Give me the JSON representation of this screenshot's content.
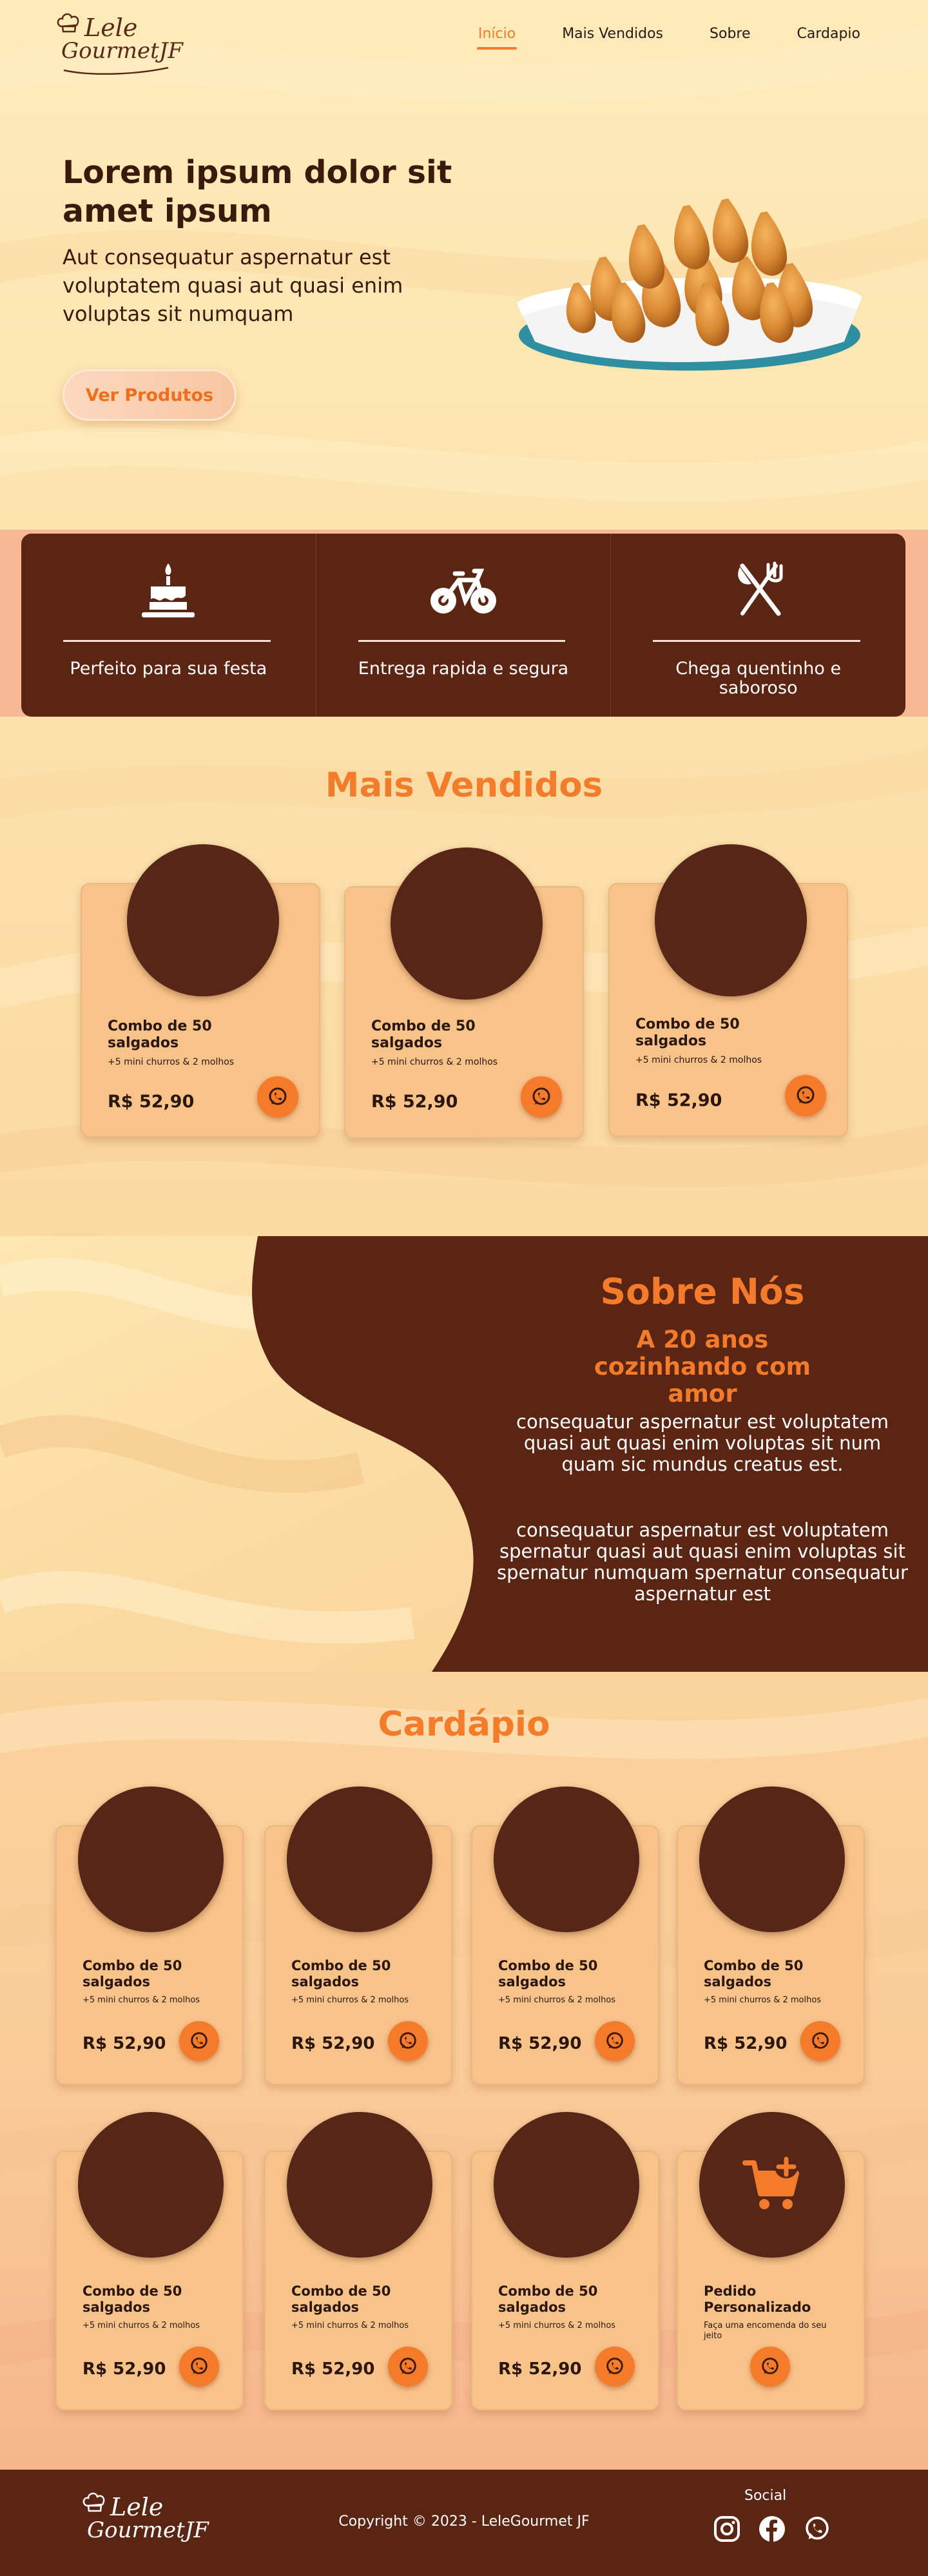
{
  "header": {
    "logo_line1": "Lele",
    "logo_line2": "GourmetJF",
    "nav": [
      {
        "label": "Início",
        "active": true
      },
      {
        "label": "Mais Vendidos",
        "active": false
      },
      {
        "label": "Sobre",
        "active": false
      },
      {
        "label": "Cardapio",
        "active": false
      }
    ]
  },
  "hero": {
    "title": "Lorem ipsum dolor sit amet ipsum",
    "subtitle": "Aut consequatur aspernatur est voluptatem quasi aut quasi enim voluptas sit numquam",
    "button": "Ver Produtos",
    "image_icon": "coxinha-plate-image"
  },
  "features": [
    {
      "icon": "cake-icon",
      "text": "Perfeito para sua festa"
    },
    {
      "icon": "bicycle-icon",
      "text": "Entrega rapida e segura"
    },
    {
      "icon": "fork-knife-icon",
      "text": "Chega quentinho e saboroso"
    }
  ],
  "best_sellers": {
    "title": "Mais Vendidos",
    "items": [
      {
        "name": "Combo de 50 salgados",
        "desc": "+5 mini churros & 2 molhos",
        "price": "R$ 52,90"
      },
      {
        "name": "Combo de 50 salgados",
        "desc": "+5 mini churros & 2 molhos",
        "price": "R$ 52,90"
      },
      {
        "name": "Combo de 50 salgados",
        "desc": "+5 mini churros & 2 molhos",
        "price": "R$ 52,90"
      }
    ]
  },
  "about": {
    "title": "Sobre Nós",
    "subtitle": "A 20 anos cozinhando com amor",
    "p1": "consequatur aspernatur est voluptatem quasi aut quasi enim voluptas sit num quam sic mundus creatus est.",
    "p2": "consequatur aspernatur est voluptatem spernatur quasi aut quasi enim voluptas sit spernatur numquam spernatur consequatur aspernatur est"
  },
  "menu": {
    "title": "Cardápio",
    "items": [
      {
        "name": "Combo de 50 salgados",
        "desc": "+5 mini churros & 2 molhos",
        "price": "R$ 52,90"
      },
      {
        "name": "Combo de 50 salgados",
        "desc": "+5 mini churros & 2 molhos",
        "price": "R$ 52,90"
      },
      {
        "name": "Combo de 50 salgados",
        "desc": "+5 mini churros & 2 molhos",
        "price": "R$ 52,90"
      },
      {
        "name": "Combo de 50 salgados",
        "desc": "+5 mini churros & 2 molhos",
        "price": "R$ 52,90"
      },
      {
        "name": "Combo de 50 salgados",
        "desc": "+5 mini churros & 2 molhos",
        "price": "R$ 52,90"
      },
      {
        "name": "Combo de 50 salgados",
        "desc": "+5 mini churros & 2 molhos",
        "price": "R$ 52,90"
      },
      {
        "name": "Combo de 50 salgados",
        "desc": "+5 mini churros & 2 molhos",
        "price": "R$ 52,90"
      }
    ],
    "custom": {
      "name": "Pedido Personalizado",
      "desc": "Faça uma encomenda do seu jeito",
      "icon": "cart-plus-icon"
    }
  },
  "footer": {
    "logo_line1": "Lele",
    "logo_line2": "GourmetJF",
    "copyright": "Copyright © 2023 - LeleGourmet JF",
    "social_title": "Social",
    "social": [
      "instagram-icon",
      "facebook-icon",
      "whatsapp-icon"
    ]
  },
  "colors": {
    "accent": "#f47b2a",
    "brown": "#5b2514",
    "card": "#f8c389"
  }
}
